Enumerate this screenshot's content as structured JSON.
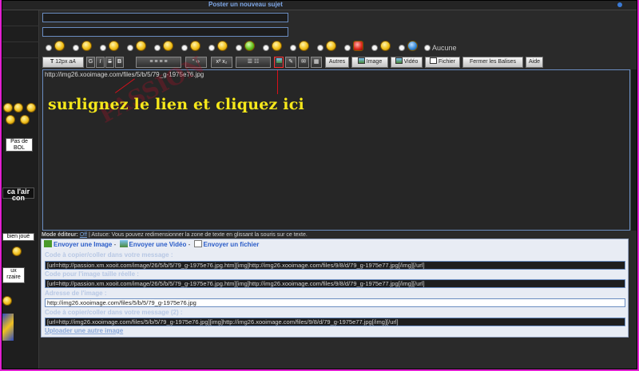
{
  "header": {
    "title": "Poster un nouveau sujet"
  },
  "sidebar": {
    "bubbles": [
      "Pas de BOL",
      "ca l'air con",
      "bien joué",
      "ux",
      "rzaire"
    ]
  },
  "editor": {
    "content": "http://img26.xooimage.com/files/5/b/5/79_g-1975e76.jpg",
    "annotation": "surlignez le lien et cliquez ici",
    "watermark": "PASSION"
  },
  "smileys": {
    "none_label": "Aucune",
    "count": 20
  },
  "toolbar": {
    "font_size": "12px",
    "buttons": [
      "G",
      "I",
      "S",
      "B"
    ],
    "other_label": "Autres",
    "image_label": "Image",
    "video_label": "Vidéo",
    "file_label": "Fichier",
    "close_tags_label": "Fermer les Balises",
    "help_label": "Aide"
  },
  "note": {
    "mode_label": "Mode éditeur:",
    "mode_value": "Off",
    "tip": "| Astuce: Vous pouvez redimensionner la zone de texte en glissant la souris sur ce texte."
  },
  "upload": {
    "send_image": "Envoyer une Image",
    "send_video": "Envoyer une Vidéo",
    "send_file": "Envoyer un fichier",
    "sep": "-",
    "label_code_copy": "Code à copier/coller dans votre message :",
    "value_code_copy": "[url=http://passion.xm.xooit.com/image/26/5/b/5/79_g-1975e76.jpg.htm][img]http://img26.xooimage.com/files/9/8/d/79_g-1975e77.jpg[/img][/url]",
    "label_code_real": "Code pour l'image taille réelle :",
    "value_code_real": "[url=http://passion.xm.xooit.com/image/26/5/b/5/79_g-1975e76.jpg.htm][img]http://img26.xooimage.com/files/9/8/d/79_g-1975e77.jpg[/img][/url]",
    "label_address": "Adresse de l'image :",
    "value_address": "http://img26.xooimage.com/files/5/b/5/79_g-1975e76.jpg",
    "label_code_copy2": "Code à copier/coller dans votre message (2) :",
    "value_code_copy2": "[url=http://img26.xooimage.com/files/5/b/5/79_g-1975e76.jpg][img]http://img26.xooimage.com/files/9/8/d/79_g-1975e77.jpg[/img][/url]",
    "other_image": "Uploader une autre image"
  }
}
